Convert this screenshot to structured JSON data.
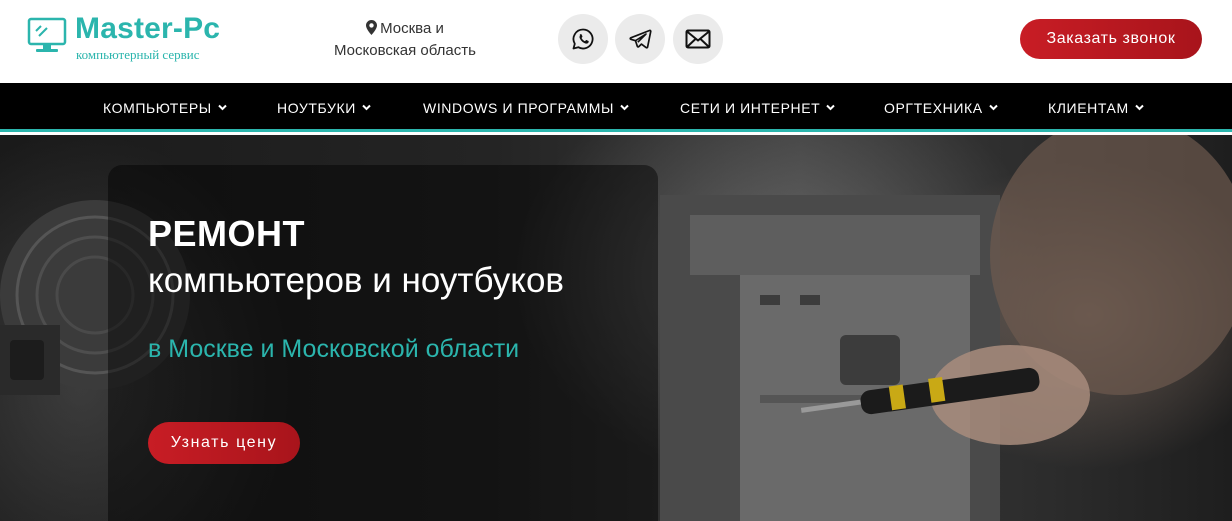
{
  "header": {
    "logo": {
      "title": "Master-Pc",
      "subtitle": "компьютерный сервис"
    },
    "region": {
      "line1": "Москва и",
      "line2": "Московская область"
    },
    "social": [
      {
        "icon": "whatsapp-icon"
      },
      {
        "icon": "telegram-icon"
      },
      {
        "icon": "email-icon"
      }
    ],
    "call_button": "Заказать звонок"
  },
  "nav": {
    "items": [
      {
        "label": "КОМПЬЮТЕРЫ"
      },
      {
        "label": "НОУТБУКИ"
      },
      {
        "label": "WINDOWS И ПРОГРАММЫ"
      },
      {
        "label": "СЕТИ И ИНТЕРНЕТ"
      },
      {
        "label": "ОРГТЕХНИКА"
      },
      {
        "label": "КЛИЕНТАМ"
      }
    ]
  },
  "hero": {
    "title": "РЕМОНТ",
    "subtitle": "компьютеров и ноутбуков",
    "region": "в Москве и Московской области",
    "button": "Узнать цену"
  },
  "colors": {
    "accent": "#2bb5ad",
    "brand_red": "#c81d25",
    "nav_bg": "#000000"
  }
}
